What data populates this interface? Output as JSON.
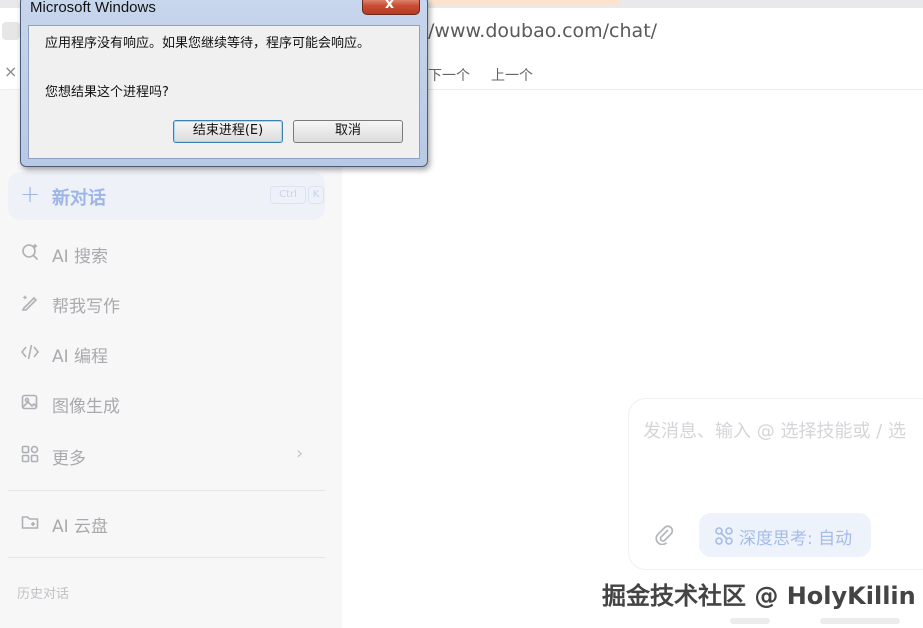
{
  "browser": {
    "url": "/www.doubao.com/chat/",
    "find_close": "×",
    "find_next": "下一个",
    "find_prev": "上一个"
  },
  "sidebar": {
    "new_chat": {
      "icon": "plus-icon",
      "label": "新对话",
      "shortcut": [
        "Ctrl",
        "K"
      ]
    },
    "items": [
      {
        "icon": "ai-search-icon",
        "label": "AI 搜索"
      },
      {
        "icon": "pen-write-icon",
        "label": "帮我写作"
      },
      {
        "icon": "code-icon",
        "label": "AI 编程"
      },
      {
        "icon": "image-gen-icon",
        "label": "图像生成"
      },
      {
        "icon": "grid-more-icon",
        "label": "更多",
        "chevron": "›"
      }
    ],
    "cloud": {
      "icon": "cloud-folder-icon",
      "label": "AI 云盘"
    },
    "history_label": "历史对话"
  },
  "composer": {
    "placeholder": "发消息、输入 @ 选择技能或 / 选",
    "deep_think_label": "深度思考: 自动"
  },
  "watermark": "掘金技术社区 @ HolyKillin",
  "dialog": {
    "title": "Microsoft Windows",
    "close_glyph": "x",
    "message": "应用程序没有响应。如果您继续等待，程序可能会响应。",
    "question": "您想结果这个进程吗?",
    "end_button": "结束进程(E)",
    "cancel_button": "取消"
  },
  "colors": {
    "accent": "#9eb5e6",
    "sidebar_bg": "#f7f7f8",
    "dialog_close": "#c74d33"
  }
}
